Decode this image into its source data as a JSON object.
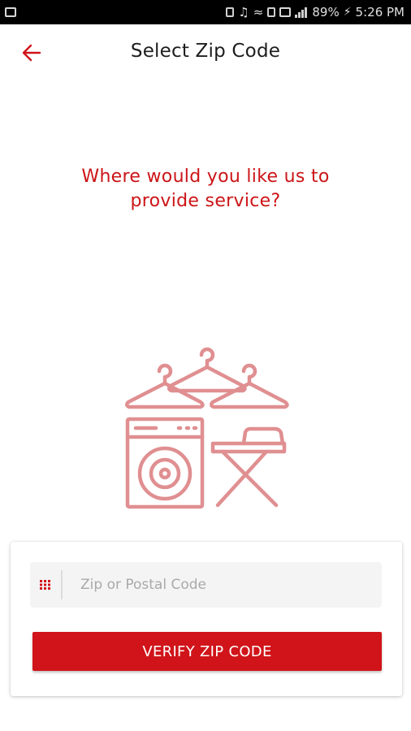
{
  "status_bar": {
    "battery": "89%",
    "time": "5:26 PM"
  },
  "header": {
    "title": "Select Zip Code",
    "back_icon": "arrow-left-icon"
  },
  "prompt": {
    "line1": "Where would you like us to",
    "line2": "provide service?"
  },
  "illustration": {
    "icon": "laundry-illustration",
    "color": "#e08f91"
  },
  "form": {
    "zip_placeholder": "Zip or Postal Code",
    "zip_value": "",
    "field_icon": "keypad-icon",
    "verify_label": "VERIFY ZIP CODE"
  },
  "colors": {
    "accent": "#d0141a",
    "prompt_text": "#cc1417",
    "illustration": "#e08f91",
    "field_bg": "#f4f4f4"
  }
}
